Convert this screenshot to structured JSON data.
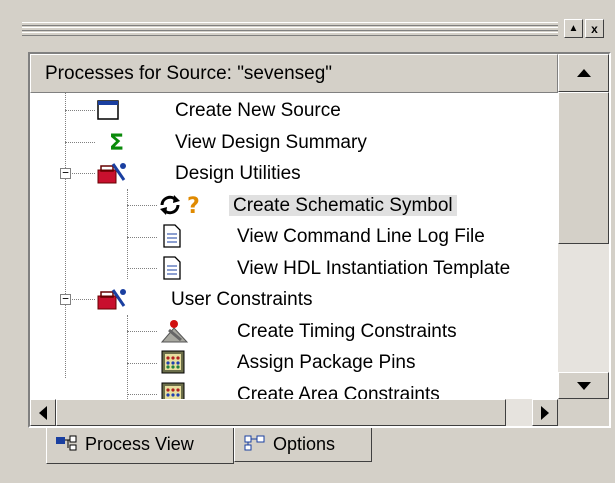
{
  "window": {
    "minimize_glyph": "▲",
    "close_glyph": "x"
  },
  "panel": {
    "header": "Processes for Source:  \"sevenseg\"",
    "tree": [
      {
        "label": "Create New Source",
        "icon": "new-source-icon",
        "level": 1
      },
      {
        "label": "View Design Summary",
        "icon": "sigma-icon",
        "level": 1
      },
      {
        "label": "Design Utilities",
        "icon": "toolbox-icon",
        "level": 1,
        "expanded": true
      },
      {
        "label": "Create Schematic Symbol",
        "icon": "refresh-question-icon",
        "level": 2,
        "selected": true
      },
      {
        "label": "View Command Line Log File",
        "icon": "document-icon",
        "level": 2
      },
      {
        "label": "View HDL Instantiation Template",
        "icon": "document-icon",
        "level": 2
      },
      {
        "label": "User Constraints",
        "icon": "toolbox-icon",
        "level": 1,
        "expanded": true
      },
      {
        "label": "Create Timing Constraints",
        "icon": "timing-tool-icon",
        "level": 2
      },
      {
        "label": "Assign Package Pins",
        "icon": "package-pins-icon",
        "level": 2
      },
      {
        "label": "Create Area Constraints",
        "icon": "area-constraints-icon",
        "level": 2
      }
    ]
  },
  "tabs": [
    {
      "label": "Process View",
      "icon": "process-view-icon",
      "active": true
    },
    {
      "label": "Options",
      "icon": "options-icon",
      "active": false
    }
  ],
  "colors": {
    "face": "#d4d0c8",
    "panel_bg": "#ffffff",
    "selection": "#e0e0e0"
  }
}
